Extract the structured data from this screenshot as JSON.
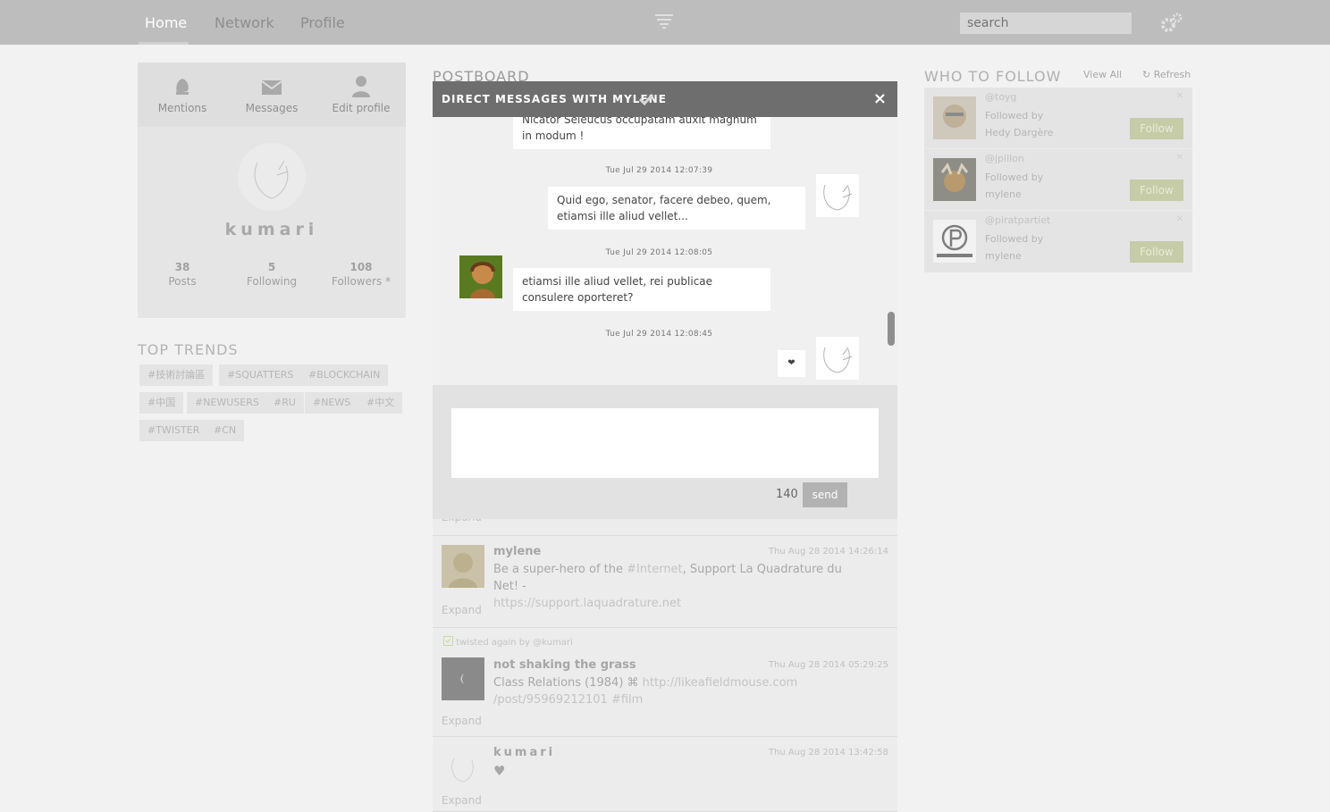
{
  "nav": {
    "home": "Home",
    "network": "Network",
    "profile": "Profile",
    "search_placeholder": "search"
  },
  "mini_nav": {
    "mentions": "Mentions",
    "messages": "Messages",
    "edit_profile": "Edit profile"
  },
  "profile": {
    "name": "kumari",
    "posts_count": "38",
    "posts_label": "Posts",
    "following_count": "5",
    "following_label": "Following",
    "followers_count": "108",
    "followers_label": "Followers *"
  },
  "trends": {
    "title": "TOP TRENDS",
    "tags": [
      "#技術討論區",
      "#SQUATTERS",
      "#BLOCKCHAIN",
      "#中国",
      "#NEWUSERS",
      "#RU",
      "#NEWS",
      "#中文",
      "#TWISTER",
      "#CN"
    ]
  },
  "postboard": {
    "title": "POSTBOARD",
    "posts": [
      {
        "expand": "Expand"
      },
      {
        "name": "mylene",
        "time": "Thu Aug 28 2014 14:26:14",
        "text_prefix": "Be a super-hero of the ",
        "hashtag": "#Internet",
        "text_suffix": ", Support La Quadrature du Net! -",
        "link": "https://support.laquadrature.net",
        "expand": "Expand"
      },
      {
        "retwist": "twisted again by @kumari",
        "name": "not shaking the grass",
        "time": "Thu Aug 28 2014 05:29:25",
        "text_prefix": "Class Relations (1984) ⌘ ",
        "link": "http://likeafieldmouse.com",
        "link2": "/post/95969212101",
        "hashtag": "#film",
        "expand": "Expand"
      },
      {
        "name": "kumari",
        "time": "Thu Aug 28 2014 13:42:58",
        "text": "♥",
        "expand": "Expand"
      }
    ]
  },
  "who_to_follow": {
    "title": "WHO TO FOLLOW",
    "view_all": "View All",
    "refresh": "Refresh",
    "users": [
      {
        "handle": "@toyg",
        "followed_by_label": "Followed by",
        "followed_by": "Hedy Dargère",
        "button": "Follow"
      },
      {
        "handle": "@jpillon",
        "followed_by_label": "Followed by",
        "followed_by": "mylene",
        "button": "Follow"
      },
      {
        "handle": "@piratpartiet",
        "followed_by_label": "Followed by",
        "followed_by": "mylene",
        "button": "Follow"
      }
    ]
  },
  "modal": {
    "title": "DIRECT MESSAGES WITH MYLENE",
    "close": "×",
    "messages": [
      {
        "from": "them",
        "text": "Nicator Seleucus occupatam auxit magnum in modum !"
      },
      {
        "time": "Tue Jul 29 2014 12:07:39",
        "from": "me",
        "text": "Quid ego, senator, facere debeo, quem, etiamsi ille aliud vellet..."
      },
      {
        "time": "Tue Jul 29 2014 12:08:05",
        "from": "them",
        "text": "etiamsi ille aliud vellet, rei publicae consulere oporteret?"
      },
      {
        "time": "Tue Jul 29 2014 12:08:45",
        "from": "me",
        "text": "❤"
      }
    ],
    "char_count": "140",
    "send": "send"
  },
  "colors": {
    "topbar": "#bdbdbd",
    "modal_header": "#6e6e6e",
    "follow_button": "#c6cba8"
  }
}
